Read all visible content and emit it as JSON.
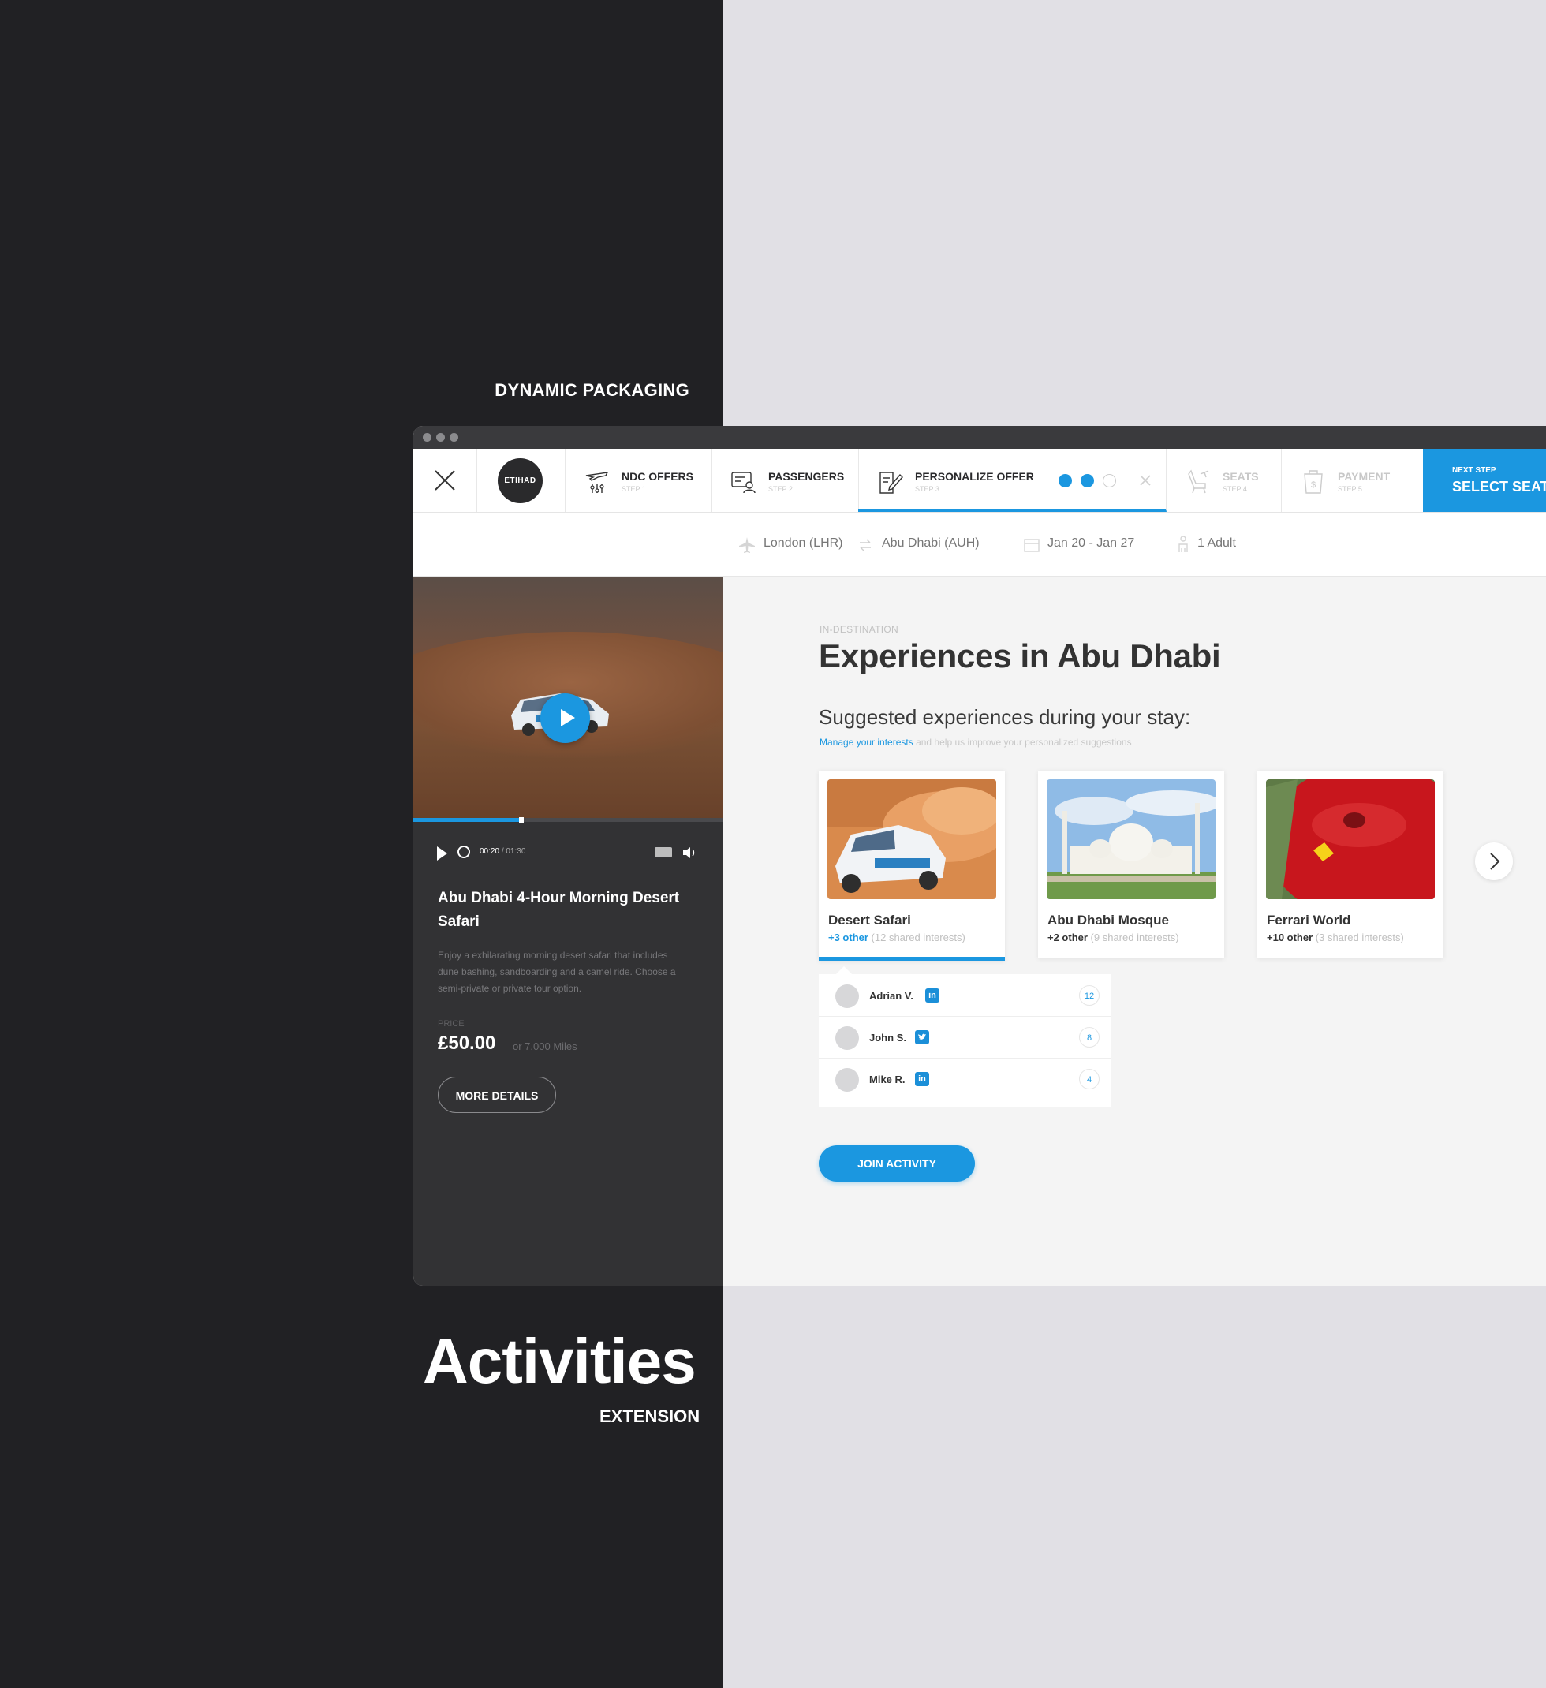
{
  "page": {
    "project_label": "DYNAMIC PACKAGING",
    "title": "Activities",
    "subtitle": "EXTENSION"
  },
  "nav": {
    "logo_text": "ETIHAD",
    "steps": [
      {
        "label": "NDC OFFERS",
        "sub": "STEP 1",
        "icon": "plane-filter-icon"
      },
      {
        "label": "PASSENGERS",
        "sub": "STEP 2",
        "icon": "passenger-card-icon"
      },
      {
        "label": "PERSONALIZE OFFER",
        "sub": "STEP 3",
        "icon": "edit-document-icon"
      },
      {
        "label": "SEATS",
        "sub": "STEP 4",
        "icon": "seat-icon"
      },
      {
        "label": "PAYMENT",
        "sub": "STEP 5",
        "icon": "payment-icon"
      }
    ],
    "next_step_label": "NEXT STEP",
    "next_step_value": "SELECT SEATS"
  },
  "trip": {
    "origin": "London (LHR)",
    "destination": "Abu Dhabi (AUH)",
    "dates": "Jan 20 - Jan 27",
    "passengers": "1 Adult"
  },
  "side": {
    "time_current": "00:20",
    "time_total": "/ 01:30",
    "video_progress": 0.35,
    "title": "Abu Dhabi 4-Hour Morning Desert Safari",
    "description": "Enjoy a exhilarating morning desert safari that includes dune bashing, sandboarding and a camel ride. Choose a semi-private or private tour option.",
    "price_label": "PRICE",
    "price": "£50.00",
    "miles": "or 7,000 Miles",
    "more_details": "MORE DETAILS"
  },
  "main": {
    "eyebrow": "IN-DESTINATION",
    "heading": "Experiences in Abu Dhabi",
    "subheading": "Suggested experiences during your stay:",
    "hint_link": "Manage your interests",
    "hint_rest": " and help us improve your personalized suggestions",
    "cards": [
      {
        "name": "Desert Safari",
        "others": "+3 other",
        "shared": " (12 shared interests)"
      },
      {
        "name": "Abu Dhabi Mosque",
        "others": "+2 other",
        "shared": " (9 shared interests)"
      },
      {
        "name": "Ferrari World",
        "others": "+10 other",
        "shared": " (3 shared interests)"
      }
    ],
    "people": [
      {
        "name": "Adrian V.",
        "social": "in",
        "count": "12"
      },
      {
        "name": "John S.",
        "social": "t",
        "count": "8"
      },
      {
        "name": "Mike R.",
        "social": "in",
        "count": "4"
      }
    ],
    "join_button": "JOIN ACTIVITY"
  },
  "colors": {
    "accent": "#1b97e0",
    "dark_panel": "#323234",
    "page_dark": "#212124",
    "page_light": "#e1e0e5"
  }
}
